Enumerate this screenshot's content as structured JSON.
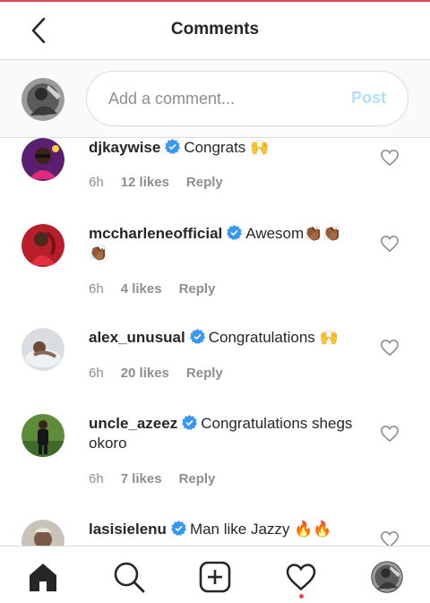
{
  "header": {
    "title": "Comments",
    "back_icon": "chevron-left-icon"
  },
  "composer": {
    "placeholder": "Add a comment...",
    "post_label": "Post"
  },
  "comments": [
    {
      "username": "djkaywise",
      "verified": true,
      "text": "Congrats 🙌",
      "time": "6h",
      "likes": "12 likes",
      "reply": "Reply"
    },
    {
      "username": "mccharleneofficial",
      "verified": true,
      "text": "Awesom👏🏾👏🏾👏🏾",
      "time": "6h",
      "likes": "4 likes",
      "reply": "Reply"
    },
    {
      "username": "alex_unusual",
      "verified": true,
      "text": "Congratulations 🙌",
      "time": "6h",
      "likes": "20 likes",
      "reply": "Reply"
    },
    {
      "username": "uncle_azeez",
      "verified": true,
      "text": "Congratulations shegs okoro",
      "time": "6h",
      "likes": "7 likes",
      "reply": "Reply"
    },
    {
      "username": "lasisielenu",
      "verified": true,
      "text": "Man like Jazzy 🔥🔥",
      "time": "",
      "likes": "",
      "reply": ""
    }
  ],
  "tabs": [
    "home-icon",
    "search-icon",
    "new-post-icon",
    "activity-heart-icon",
    "profile-avatar"
  ],
  "colors": {
    "verified": "#3897f0",
    "post_disabled": "#b2dffc",
    "notification_dot": "#ed4956"
  }
}
